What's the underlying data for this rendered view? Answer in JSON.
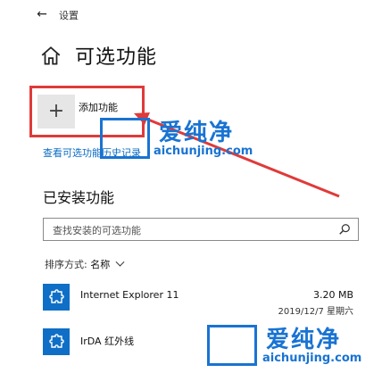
{
  "header": {
    "back_glyph": "←",
    "window_title": "设置"
  },
  "page": {
    "title": "可选功能",
    "home_icon": "home-icon"
  },
  "add_feature": {
    "label": "添加功能",
    "glyph": "+"
  },
  "history_link": "查看可选功能历史记录",
  "installed": {
    "heading": "已安装功能",
    "search_placeholder": "查找安装的可选功能",
    "sort_label": "排序方式:",
    "sort_value": "名称",
    "items": [
      {
        "name": "Internet Explorer 11",
        "size": "3.20 MB",
        "date": "2019/12/7 星期六",
        "icon": "puzzle-icon"
      },
      {
        "name": "IrDA 红外线",
        "size": "",
        "date": "",
        "icon": "puzzle-icon"
      }
    ]
  },
  "watermark": {
    "text": "爱纯净",
    "url": "aichunjing.com"
  },
  "colors": {
    "accent": "#0f6fc6",
    "highlight": "#e03a3a",
    "link": "#0a6cc4",
    "watermark": "#1973d2"
  }
}
